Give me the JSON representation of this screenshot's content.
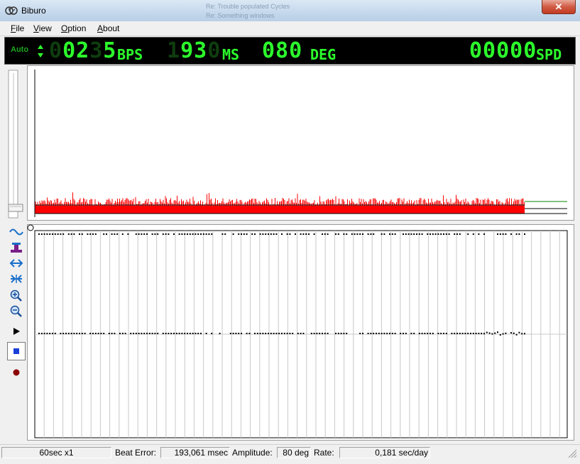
{
  "window": {
    "title": "Biburo",
    "close": "✕"
  },
  "background_window_text": [
    "Re: Trouble populated Cycles",
    "Re: Something windows"
  ],
  "menu": [
    "File",
    "View",
    "Option",
    "About"
  ],
  "display": {
    "mode": "Auto",
    "bps": {
      "ghost_left": "0",
      "value": "02",
      "ghost_mid": "3",
      "value2": "5",
      "unit": "BPS"
    },
    "ms": {
      "ghost_left": "1",
      "value": "93",
      "ghost_right": "0",
      "unit": "MS"
    },
    "deg": {
      "value": "080",
      "unit": "DEG"
    },
    "spd": {
      "value": "00000",
      "unit": "SPD"
    },
    "accent_color": "#2cff2c"
  },
  "toolbar": {
    "icons": [
      "sine-wave-icon",
      "stand-icon",
      "stretch-horizontal-icon",
      "compress-icon",
      "zoom-in-icon",
      "zoom-out-icon",
      "play-icon",
      "stop-icon",
      "record-icon"
    ]
  },
  "amplitude_plot": {
    "bar_color": "#ff0000",
    "line_color": "#008000",
    "seed": 7
  },
  "beat_plot": {
    "rows": 2,
    "seed": 3
  },
  "status": {
    "window": "60sec x1",
    "beat_error_label": "Beat Error:",
    "beat_error_value": "193,061 msec",
    "amplitude_label": "Amplitude:",
    "amplitude_value": "80 deg",
    "rate_label": "Rate:",
    "rate_value": "0,181 sec/day"
  }
}
